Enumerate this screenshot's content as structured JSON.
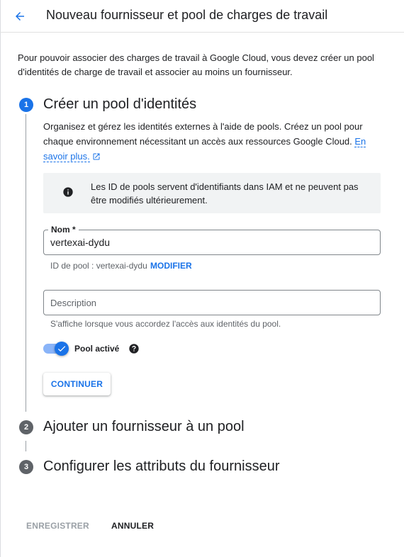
{
  "header": {
    "back_icon": "arrow-back-icon",
    "title": "Nouveau fournisseur et pool de charges de travail"
  },
  "intro": "Pour pouvoir associer des charges de travail à Google Cloud, vous devez créer un pool d'identités de charge de travail et associer au moins un fournisseur.",
  "steps": [
    {
      "number": "1",
      "title": "Créer un pool d'identités",
      "description": "Organisez et gérez les identités externes à l'aide de pools. Créez un pool pour chaque environnement nécessitant un accès aux ressources Google Cloud.",
      "learn_more": "En savoir plus.",
      "info_text": "Les ID de pools servent d'identifiants dans IAM et ne peuvent pas être modifiés ultérieurement.",
      "name_field": {
        "label": "Nom *",
        "value": "vertexai-dydu"
      },
      "pool_id_hint": "ID de pool : vertexai-dydu",
      "modify_label": "MODIFIER",
      "description_field": {
        "placeholder": "Description",
        "value": ""
      },
      "description_hint": "S'affiche lorsque vous accordez l'accès aux identités du pool.",
      "toggle_label": "Pool activé",
      "toggle_on": true,
      "continue_label": "CONTINUER"
    },
    {
      "number": "2",
      "title": "Ajouter un fournisseur à un pool"
    },
    {
      "number": "3",
      "title": "Configurer les attributs du fournisseur"
    }
  ],
  "footer": {
    "save_label": "ENREGISTRER",
    "cancel_label": "ANNULER"
  },
  "colors": {
    "accent": "#1a73e8",
    "inactive_step": "#5f6368",
    "info_background": "#f1f3f4"
  }
}
